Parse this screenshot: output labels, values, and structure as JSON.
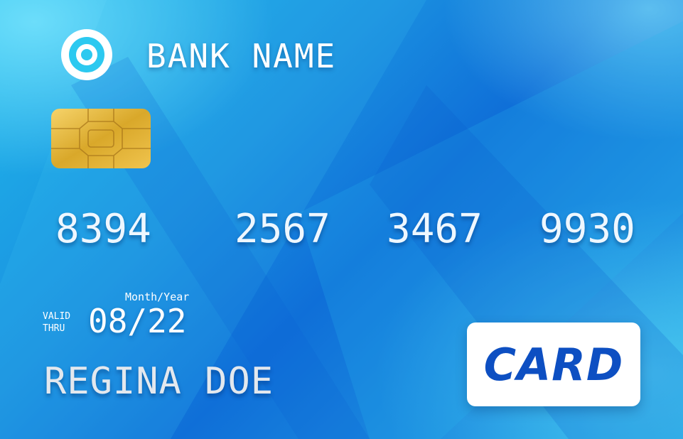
{
  "bank": {
    "name": "BANK NAME",
    "logo_icon": "circle-logo-icon"
  },
  "chip": {
    "icon": "emv-chip-icon",
    "color": "#d9a82a"
  },
  "card_number": {
    "groups": [
      "8394",
      "2567",
      "3467",
      "9930"
    ]
  },
  "validity": {
    "format_label": "Month/Year",
    "valid_label_line1": "VALID",
    "valid_label_line2": "THRU",
    "expiry": "08/22"
  },
  "holder": {
    "name": "REGINA DOE"
  },
  "badge": {
    "label": "CARD",
    "color": "#0d4fc2"
  },
  "colors": {
    "background": "#1a8fe0",
    "accent": "#2cc9f0"
  }
}
